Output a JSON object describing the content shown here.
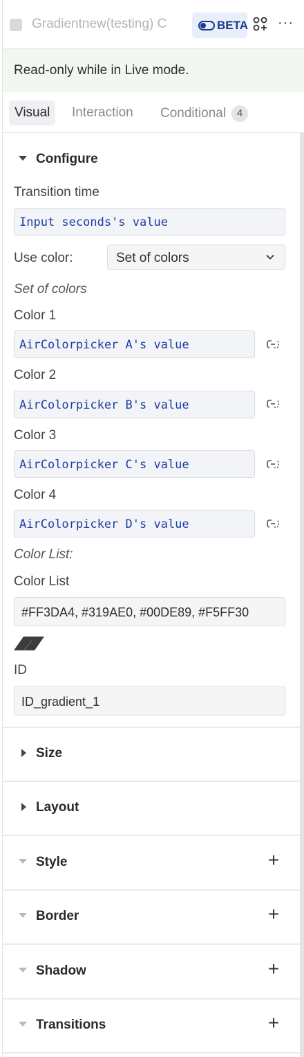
{
  "header": {
    "title": "Gradientnew(testing) C",
    "beta_label": "BETA",
    "beta_icon": "toggle-icon",
    "apps_icon": "apps-add-icon",
    "more_icon": "more-horizontal-icon",
    "more_glyph": "···"
  },
  "banner": {
    "text": "Read-only while in Live mode."
  },
  "tabs": [
    {
      "label": "Visual",
      "active": true
    },
    {
      "label": "Interaction",
      "active": false
    },
    {
      "label": "Conditional",
      "active": false,
      "badge": "4"
    }
  ],
  "configure": {
    "title": "Configure",
    "transition_time_label": "Transition time",
    "transition_time_value": "Input seconds's value",
    "use_color_label": "Use color:",
    "use_color_value": "Set of colors",
    "set_of_colors_heading": "Set of colors",
    "colors": [
      {
        "label": "Color 1",
        "value": "AirColorpicker A's value"
      },
      {
        "label": "Color 2",
        "value": "AirColorpicker B's value"
      },
      {
        "label": "Color 3",
        "value": "AirColorpicker C's value"
      },
      {
        "label": "Color 4",
        "value": "AirColorpicker D's value"
      }
    ],
    "color_list_heading": "Color List:",
    "color_list_label": "Color List",
    "color_list_value": "#FF3DA4, #319AE0, #00DE89, #F5FF30",
    "id_label": "ID",
    "id_value": "ID_gradient_1"
  },
  "sections": [
    {
      "title": "Size",
      "expanded": false,
      "has_add": false
    },
    {
      "title": "Layout",
      "expanded": false,
      "has_add": false
    },
    {
      "title": "Style",
      "expanded": false,
      "has_add": true
    },
    {
      "title": "Border",
      "expanded": false,
      "has_add": true
    },
    {
      "title": "Shadow",
      "expanded": false,
      "has_add": true
    },
    {
      "title": "Transitions",
      "expanded": false,
      "has_add": true
    }
  ],
  "plus_glyph": "+",
  "colors": {
    "accent": "#1d3a8a",
    "code_text": "#1f3ea0",
    "banner_bg": "#f2f7f2"
  }
}
